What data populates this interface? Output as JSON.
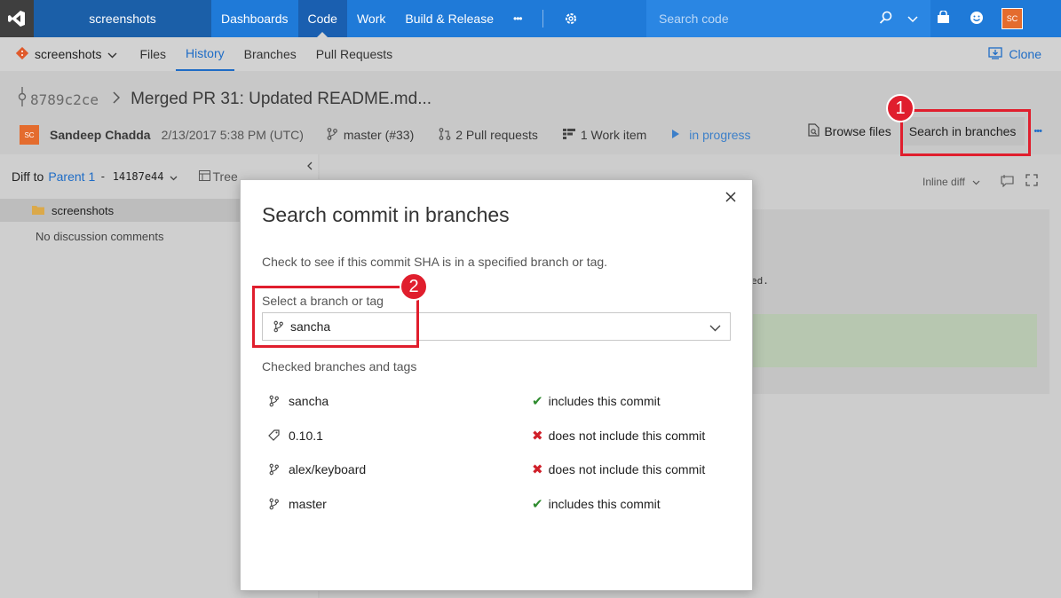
{
  "topbar": {
    "project": "screenshots",
    "nav": [
      "Dashboards",
      "Code",
      "Work",
      "Build & Release"
    ],
    "more": "•••",
    "search_placeholder": "Search code",
    "user_initials": "SC"
  },
  "subnav": {
    "repo": "screenshots",
    "tabs": [
      "Files",
      "History",
      "Branches",
      "Pull Requests"
    ],
    "clone": "Clone"
  },
  "commit": {
    "sha": "8789c2ce",
    "title": "Merged PR 31: Updated README.md...",
    "avatar_initials": "SC",
    "author": "Sandeep Chadda",
    "date": "2/13/2017 5:38 PM (UTC)",
    "branch": "master (#33)",
    "pull_requests": "2 Pull requests",
    "work_items": "1 Work item",
    "status": "in progress",
    "browse_files": "Browse files",
    "search_in_branches": "Search in branches",
    "more": "•••"
  },
  "left": {
    "diff_to": "Diff to",
    "parent": "Parent 1",
    "parent_sha": "- 14187e44",
    "tree": "Tree",
    "folder": "screenshots",
    "no_discussion": "No discussion comments"
  },
  "main": {
    "inline_diff": "Inline diff",
    "code_fragment": "ed."
  },
  "annotations": {
    "badge1": "1",
    "badge2": "2",
    "color": "#e01e2d"
  },
  "dialog": {
    "title": "Search commit in branches",
    "description": "Check to see if this commit SHA is in a specified branch or tag.",
    "select_label": "Select a branch or tag",
    "selected": "sancha",
    "checked_label": "Checked branches and tags",
    "items": [
      {
        "name": "sancha",
        "icon": "branch-icon",
        "status": "includes this commit",
        "included": true
      },
      {
        "name": "0.10.1",
        "icon": "tag-icon",
        "status": "does not include this commit",
        "included": false
      },
      {
        "name": "alex/keyboard",
        "icon": "branch-icon",
        "status": "does not include this commit",
        "included": false
      },
      {
        "name": "master",
        "icon": "branch-icon",
        "status": "includes this commit",
        "included": true
      }
    ]
  }
}
